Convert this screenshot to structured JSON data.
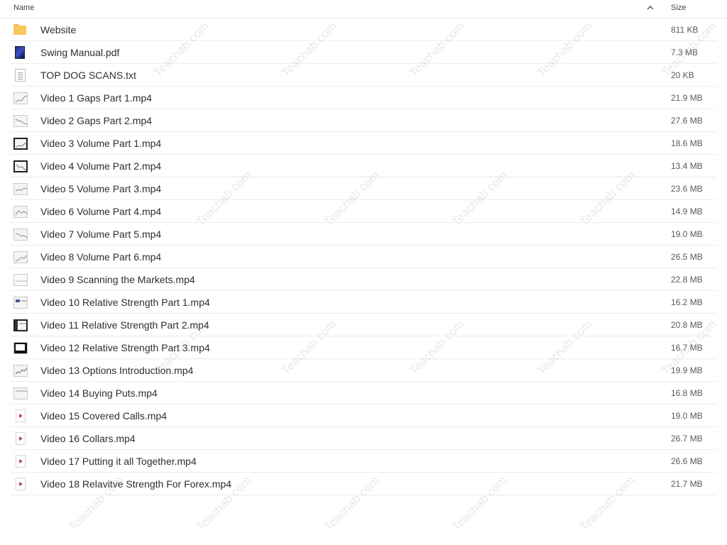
{
  "header": {
    "name_label": "Name",
    "size_label": "Size"
  },
  "watermark": "Teachab.com",
  "files": [
    {
      "name": "Website",
      "size": "811 KB",
      "icon": "folder-icon"
    },
    {
      "name": "Swing Manual.pdf",
      "size": "7.3 MB",
      "icon": "pdf-icon"
    },
    {
      "name": "TOP DOG SCANS.txt",
      "size": "20 KB",
      "icon": "text-file-icon"
    },
    {
      "name": "Video 1 Gaps Part 1.mp4",
      "size": "21.9 MB",
      "icon": "video-thumbnail-icon"
    },
    {
      "name": "Video 2 Gaps Part 2.mp4",
      "size": "27.6 MB",
      "icon": "video-thumbnail-icon"
    },
    {
      "name": "Video 3 Volume Part 1.mp4",
      "size": "18.6 MB",
      "icon": "video-thumbnail-icon"
    },
    {
      "name": "Video 4 Volume Part 2.mp4",
      "size": "13.4 MB",
      "icon": "video-thumbnail-icon"
    },
    {
      "name": "Video 5 Volume Part 3.mp4",
      "size": "23.6 MB",
      "icon": "video-thumbnail-icon"
    },
    {
      "name": "Video 6 Volume Part 4.mp4",
      "size": "14.9 MB",
      "icon": "video-thumbnail-icon"
    },
    {
      "name": "Video 7 Volume Part 5.mp4",
      "size": "19.0 MB",
      "icon": "video-thumbnail-icon"
    },
    {
      "name": "Video 8 Volume Part 6.mp4",
      "size": "26.5 MB",
      "icon": "video-thumbnail-icon"
    },
    {
      "name": "Video 9 Scanning the Markets.mp4",
      "size": "22.8 MB",
      "icon": "video-thumbnail-icon"
    },
    {
      "name": "Video 10 Relative Strength Part 1.mp4",
      "size": "16.2 MB",
      "icon": "video-thumbnail-icon"
    },
    {
      "name": "Video 11 Relative Strength Part 2.mp4",
      "size": "20.8 MB",
      "icon": "video-thumbnail-icon"
    },
    {
      "name": "Video 12 Relative Strength Part 3.mp4",
      "size": "16.7 MB",
      "icon": "video-thumbnail-icon"
    },
    {
      "name": "Video 13 Options Introduction.mp4",
      "size": "19.9 MB",
      "icon": "video-thumbnail-icon"
    },
    {
      "name": "Video 14 Buying Puts.mp4",
      "size": "16.8 MB",
      "icon": "video-thumbnail-icon"
    },
    {
      "name": "Video 15 Covered Calls.mp4",
      "size": "19.0 MB",
      "icon": "video-file-icon"
    },
    {
      "name": "Video 16 Collars.mp4",
      "size": "26.7 MB",
      "icon": "video-file-icon"
    },
    {
      "name": "Video 17 Putting it all Together.mp4",
      "size": "26.6 MB",
      "icon": "video-file-icon"
    },
    {
      "name": "Video 18 Relavitve Strength For Forex.mp4",
      "size": "21.7 MB",
      "icon": "video-file-icon"
    }
  ]
}
